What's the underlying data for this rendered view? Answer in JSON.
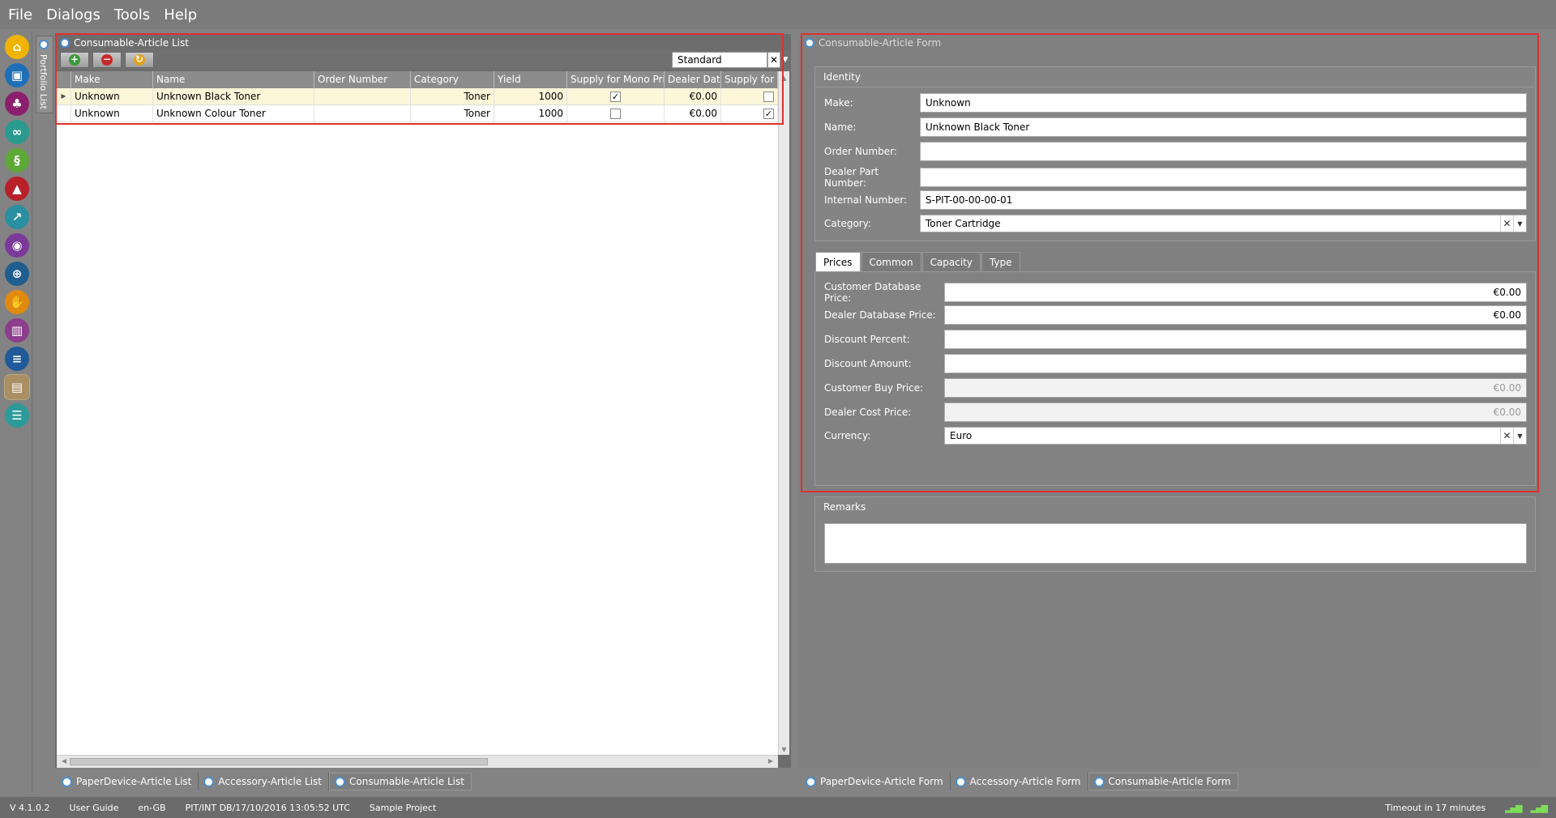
{
  "menu": [
    "File",
    "Dialogs",
    "Tools",
    "Help"
  ],
  "sidebar": {
    "portfolio_label": "Portfolio List",
    "icons": [
      {
        "name": "home-icon",
        "color": "#f0b400",
        "glyph": "⌂"
      },
      {
        "name": "folder-icon",
        "color": "#1f6fb8",
        "glyph": "▣"
      },
      {
        "name": "hierarchy-icon",
        "color": "#8b1f6e",
        "glyph": "♣"
      },
      {
        "name": "binoculars-icon",
        "color": "#2b9a8e",
        "glyph": "∞"
      },
      {
        "name": "scroll-icon",
        "color": "#5da836",
        "glyph": "§"
      },
      {
        "name": "chart-area-icon",
        "color": "#b8202a",
        "glyph": "▲"
      },
      {
        "name": "trend-icon",
        "color": "#2a8fa0",
        "glyph": "↗"
      },
      {
        "name": "eye-icon",
        "color": "#7a3a9a",
        "glyph": "◉"
      },
      {
        "name": "target-icon",
        "color": "#1f5e8f",
        "glyph": "⊕"
      },
      {
        "name": "handshake-icon",
        "color": "#e08a10",
        "glyph": "✋"
      },
      {
        "name": "bars-icon",
        "color": "#8c3d8c",
        "glyph": "▥"
      },
      {
        "name": "document-icon",
        "color": "#1f5a9a",
        "glyph": "≡"
      },
      {
        "name": "briefcase-icon",
        "color": "#a98f63",
        "glyph": "▤"
      },
      {
        "name": "database-icon",
        "color": "#2d9a9a",
        "glyph": "☰"
      }
    ]
  },
  "list_panel": {
    "title": "Consumable-Article List",
    "view_combo": "Standard",
    "columns": [
      "Make",
      "Name",
      "Order Number",
      "Category",
      "Yield",
      "Supply for Mono Pri",
      "Dealer Dat",
      "Supply for C"
    ],
    "rows": [
      {
        "make": "Unknown",
        "name": "Unknown Black Toner",
        "order": "",
        "category": "Toner",
        "yield": "1000",
        "mono": true,
        "dealer": "€0.00",
        "colour": false
      },
      {
        "make": "Unknown",
        "name": "Unknown Colour Toner",
        "order": "",
        "category": "Toner",
        "yield": "1000",
        "mono": false,
        "dealer": "€0.00",
        "colour": true
      }
    ],
    "tabs": [
      "PaperDevice-Article List",
      "Accessory-Article List",
      "Consumable-Article List"
    ]
  },
  "form_panel": {
    "title": "Consumable-Article Form",
    "identity": {
      "group_title": "Identity",
      "make_label": "Make:",
      "make_value": "Unknown",
      "name_label": "Name:",
      "name_value": "Unknown Black Toner",
      "order_label": "Order Number:",
      "order_value": "",
      "dealer_part_label": "Dealer Part Number:",
      "dealer_part_value": "",
      "internal_label": "Internal Number:",
      "internal_value": "S-PIT-00-00-00-01",
      "category_label": "Category:",
      "category_value": "Toner Cartridge"
    },
    "tabs": [
      "Prices",
      "Common",
      "Capacity",
      "Type"
    ],
    "prices": {
      "customer_db_label": "Customer Database Price:",
      "customer_db_value": "€0.00",
      "dealer_db_label": "Dealer Database Price:",
      "dealer_db_value": "€0.00",
      "discount_pct_label": "Discount Percent:",
      "discount_pct_value": "",
      "discount_amt_label": "Discount Amount:",
      "discount_amt_value": "",
      "customer_buy_label": "Customer Buy Price:",
      "customer_buy_value": "€0.00",
      "dealer_cost_label": "Dealer Cost Price:",
      "dealer_cost_value": "€0.00",
      "currency_label": "Currency:",
      "currency_value": "Euro"
    },
    "remarks_title": "Remarks",
    "bottom_tabs": [
      "PaperDevice-Article Form",
      "Accessory-Article Form",
      "Consumable-Article Form"
    ]
  },
  "status": {
    "version": "V 4.1.0.2",
    "user_guide": "User Guide",
    "locale": "en-GB",
    "db": "PIT/INT DB/17/10/2016 13:05:52 UTC",
    "project": "Sample Project",
    "timeout": "Timeout in 17 minutes"
  },
  "colors": {
    "highlight": "#e03030",
    "selected_row": "#fdf6d9",
    "tab_dot": "#4a8ecf"
  }
}
